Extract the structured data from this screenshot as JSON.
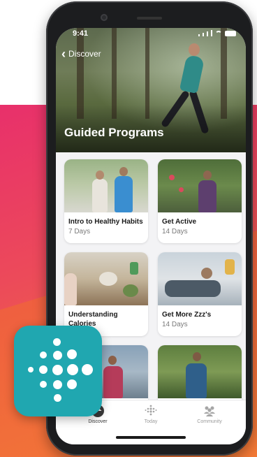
{
  "status_bar": {
    "time": "9:41"
  },
  "nav": {
    "back_label": "Discover"
  },
  "page": {
    "title": "Guided Programs"
  },
  "programs": [
    {
      "title": "Intro to Healthy Habits",
      "duration": "7 Days"
    },
    {
      "title": "Get Active",
      "duration": "14 Days"
    },
    {
      "title": "Understanding Calories",
      "duration": ""
    },
    {
      "title": "Get More Zzz's",
      "duration": "14 Days"
    },
    {
      "title": "",
      "duration": ""
    },
    {
      "title": "",
      "duration": ""
    }
  ],
  "tab_bar": {
    "items": [
      {
        "label": "Discover",
        "icon": "compass-icon",
        "active": true
      },
      {
        "label": "Today",
        "icon": "dots-icon",
        "active": false
      },
      {
        "label": "Community",
        "icon": "people-icon",
        "active": false
      }
    ]
  },
  "brand": {
    "logo": "fitbit-logo-icon",
    "color": "#20a7b0"
  },
  "colors": {
    "gradient_start": "#e8306b",
    "gradient_end": "#f2793a"
  }
}
